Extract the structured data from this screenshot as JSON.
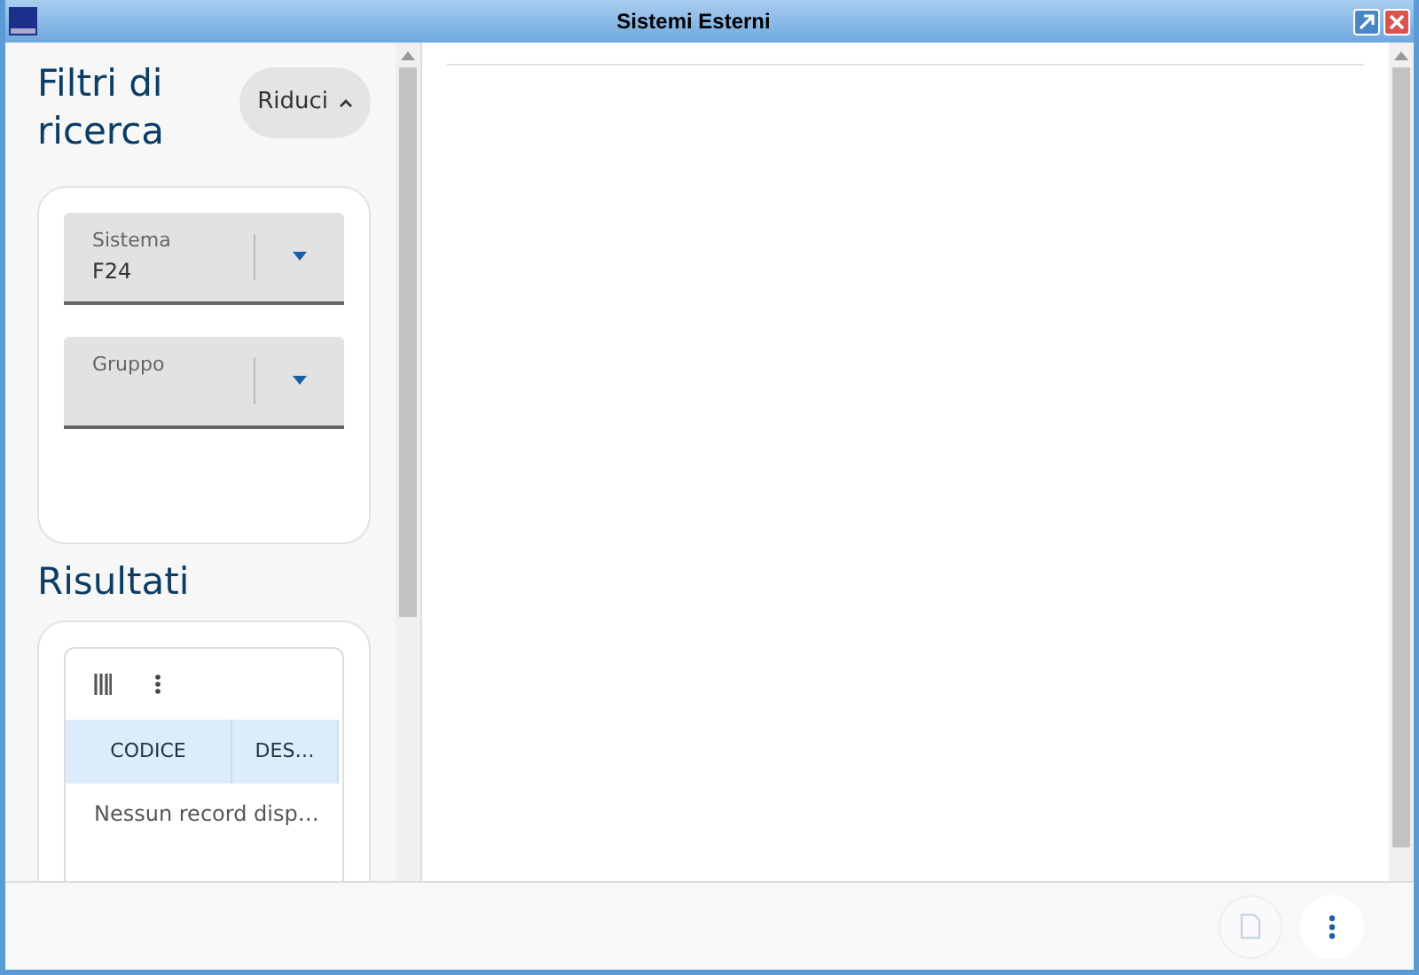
{
  "window": {
    "title": "Sistemi Esterni"
  },
  "filters": {
    "title": "Filtri di ricerca",
    "collapse_button": "Riduci",
    "fields": [
      {
        "label": "Sistema",
        "value": "F24"
      },
      {
        "label": "Gruppo"
      }
    ]
  },
  "results": {
    "title": "Risultati",
    "columns": [
      "CODICE",
      "DES…"
    ],
    "empty_message": "Nessun record disp…"
  }
}
